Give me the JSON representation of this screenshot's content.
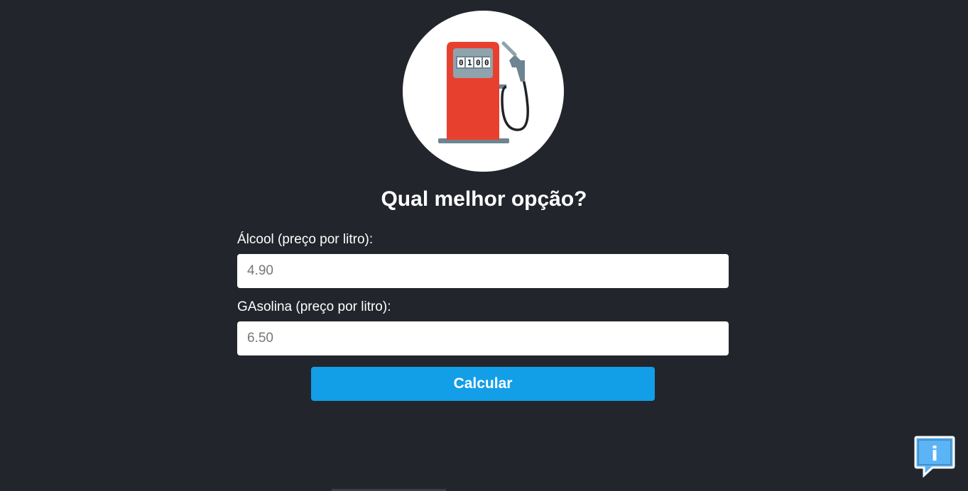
{
  "logo": {
    "icon": "fuel-pump-icon",
    "counter_digits": [
      "0",
      "1",
      "0",
      "0"
    ]
  },
  "heading": "Qual melhor opção?",
  "form": {
    "alcool_label": "Álcool (preço por litro):",
    "alcool_placeholder": "4.90",
    "gasolina_label": "GAsolina (preço por litro):",
    "gasolina_placeholder": "6.50",
    "submit_label": "Calcular"
  },
  "info_button": {
    "icon": "info-icon",
    "glyph": "i"
  },
  "colors": {
    "background": "#22252c",
    "button": "#139ee8",
    "pump": "#e8402f",
    "info": "#5ab4f5"
  }
}
